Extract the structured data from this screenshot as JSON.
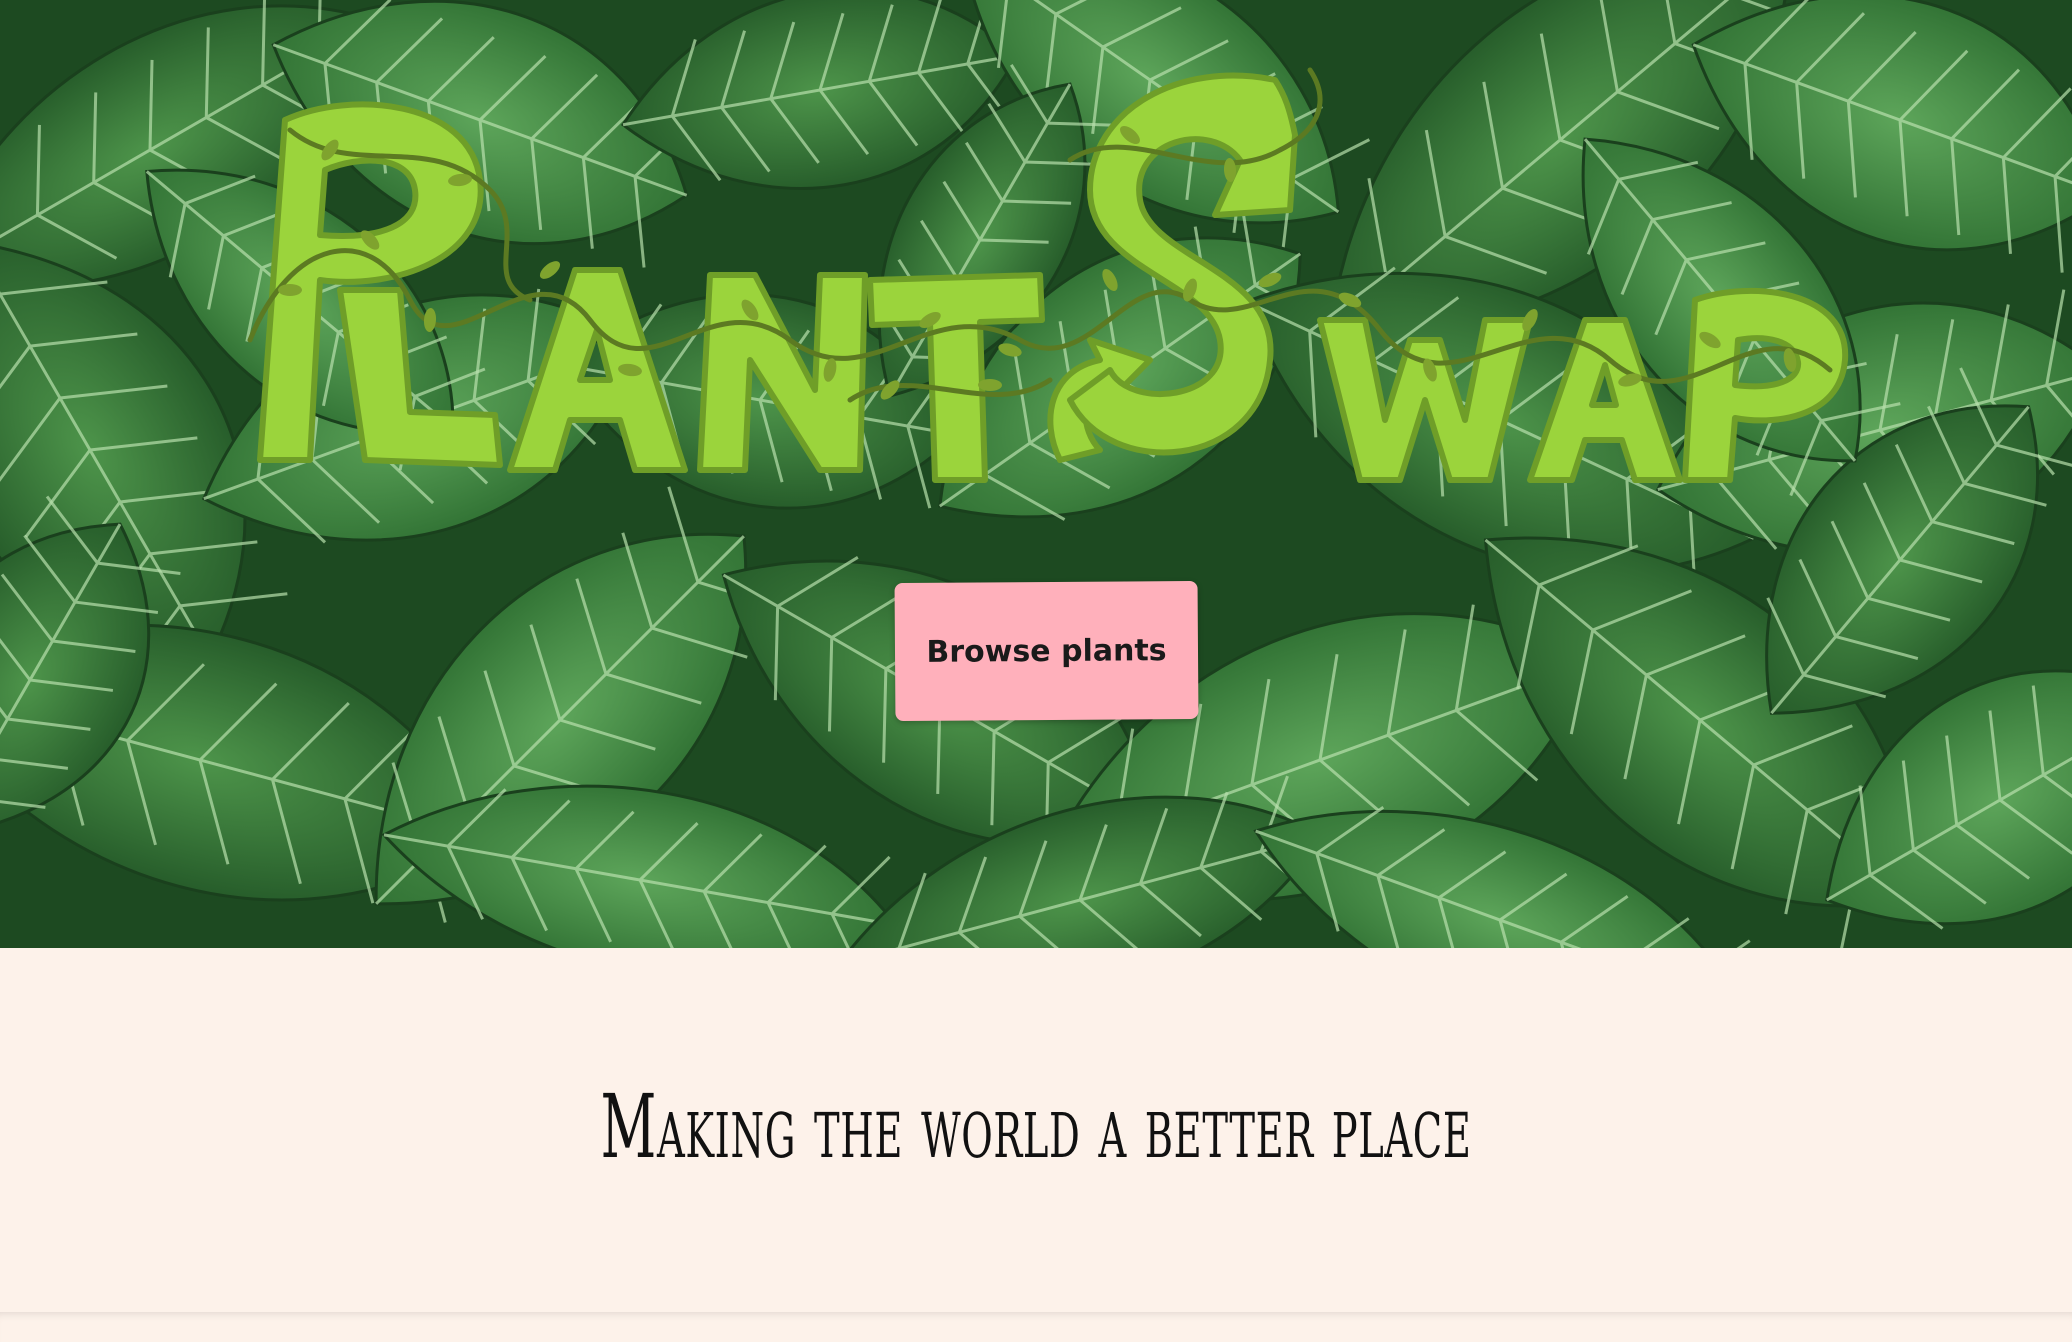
{
  "hero": {
    "logo_text": "PlantSwap",
    "browse_button_label": "Browse plants",
    "background_description_icon": "leaves-background"
  },
  "tagline": {
    "text": "Making the world a better place"
  },
  "colors": {
    "hero_dark": "#1e4a22",
    "leaf_light": "#9bd43c",
    "vine": "#5c7a22",
    "button_pink": "#ffb0bb",
    "page_cream": "#fdf2ea"
  }
}
